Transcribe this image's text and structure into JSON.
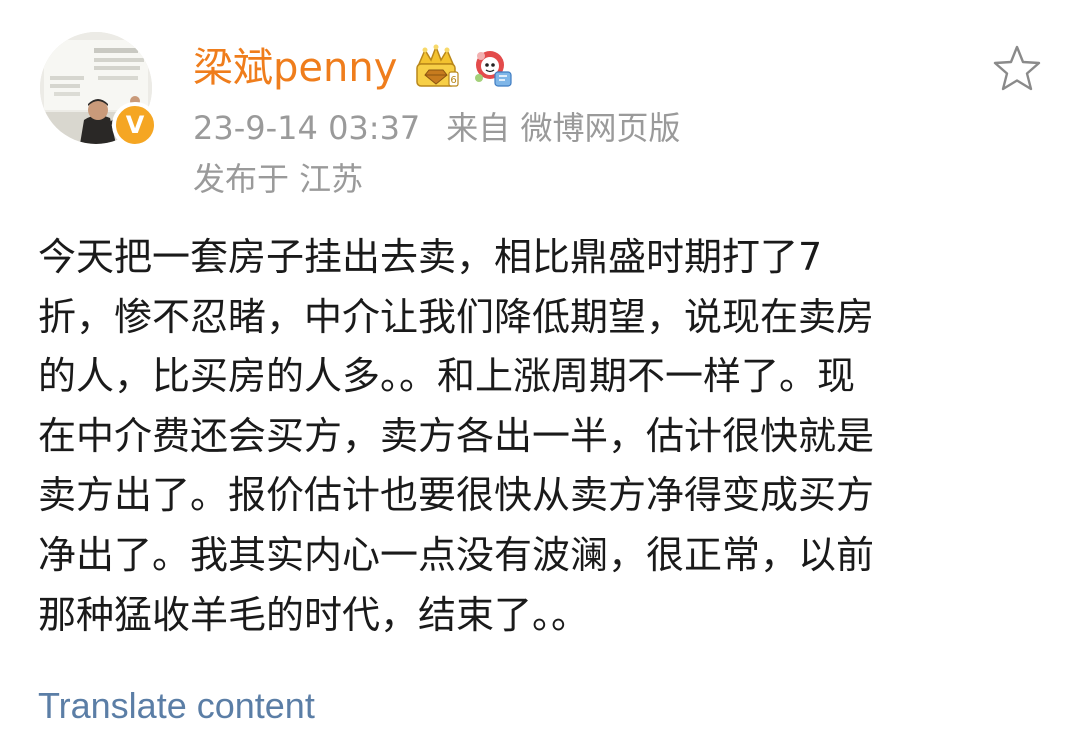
{
  "post": {
    "author": {
      "name": "梁斌penny",
      "avatar_icon": "avatar-photo-icon",
      "verified_badge_text": "V",
      "verified_color": "#f5a623",
      "badges": [
        "crown-vip-icon",
        "mascot-badge-icon"
      ]
    },
    "timestamp": "23-9-14 03:37",
    "source": "来自 微博网页版",
    "location": "发布于 江苏",
    "body": "今天把一套房子挂出去卖，相比鼎盛时期打了7\n折，惨不忍睹，中介让我们降低期望，说现在卖房\n的人，比买房的人多。。和上涨周期不一样了。现\n在中介费还会买方，卖方各出一半，估计很快就是\n卖方出了。报价估计也要很快从卖方净得变成买方\n净出了。我其实内心一点没有波澜，很正常，以前\n那种猛收羊毛的时代，结束了。。",
    "translate_label": "Translate content",
    "favorite_icon": "star-outline-icon"
  },
  "colors": {
    "username": "#ef7d1c",
    "meta": "#9a9a9a",
    "body_text": "#1a1a1a",
    "link": "#5b7ea6",
    "background": "#ffffff"
  }
}
